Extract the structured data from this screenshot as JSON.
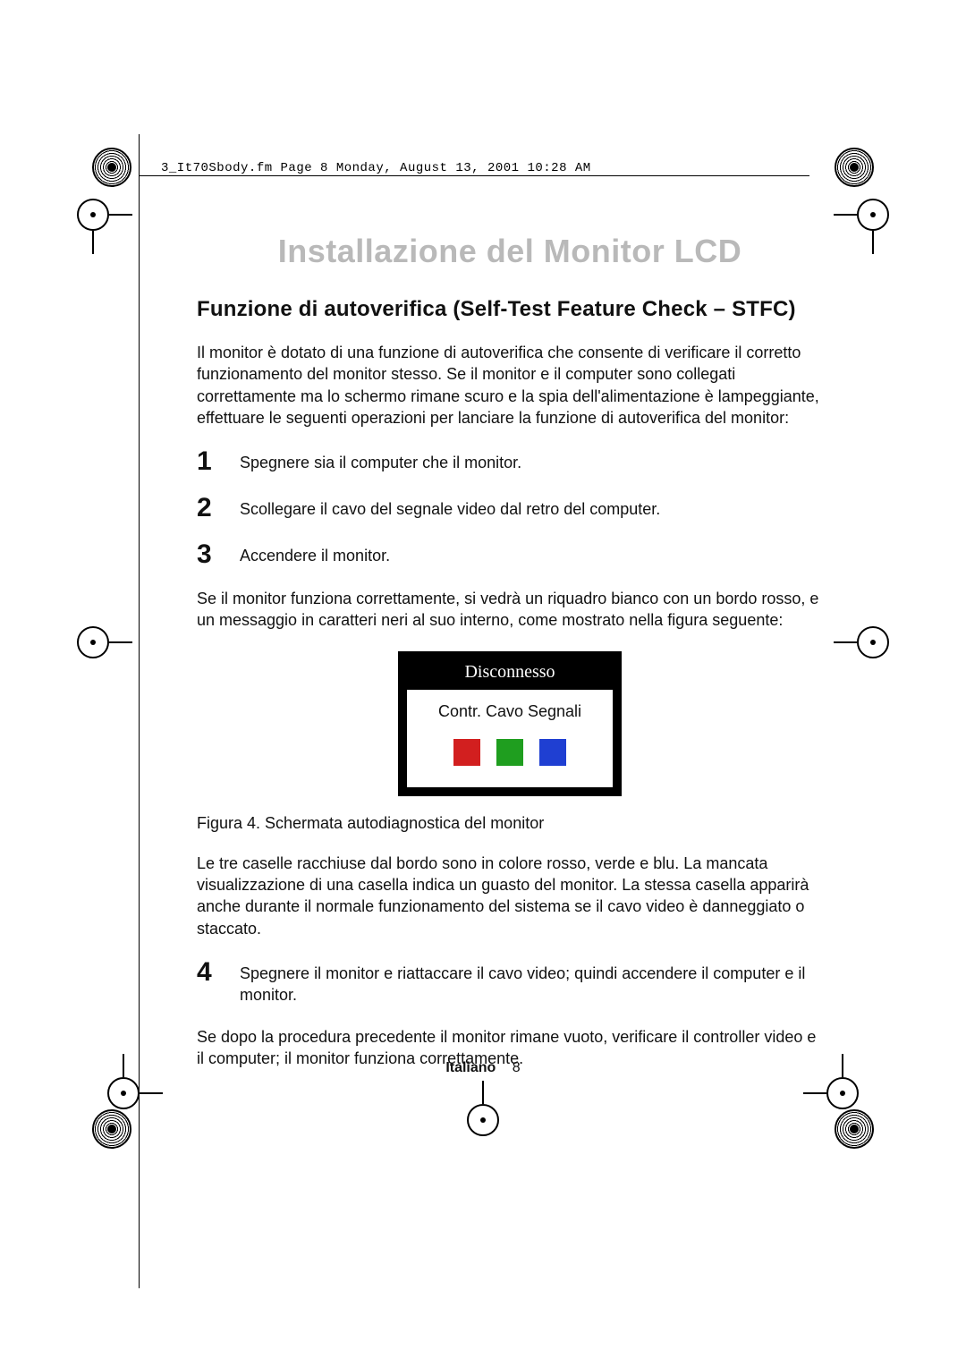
{
  "header_line": "3_It70Sbody.fm  Page 8  Monday, August 13, 2001  10:28 AM",
  "title": "Installazione del Monitor LCD",
  "subtitle": "Funzione di autoverifica (Self-Test Feature Check – STFC)",
  "intro": "Il monitor è dotato di una funzione di autoverifica che consente di verificare il corretto funzionamento del monitor stesso. Se il monitor e il computer sono collegati correttamente ma lo schermo rimane scuro e la spia dell'alimentazione è lampeggiante, effettuare le seguenti operazioni per lanciare la funzione di autoverifica del monitor:",
  "steps": {
    "s1": {
      "num": "1",
      "text": "Spegnere sia il computer che il monitor."
    },
    "s2": {
      "num": "2",
      "text": "Scollegare il cavo del segnale video dal retro del computer."
    },
    "s3": {
      "num": "3",
      "text": "Accendere il monitor."
    }
  },
  "after_steps": "Se il monitor funziona correttamente, si vedrà un riquadro bianco con un bordo rosso, e un messaggio in caratteri neri al suo interno, come mostrato nella figura seguente:",
  "figure": {
    "outer_label": "Disconnesso",
    "inner_label": "Contr. Cavo Segnali",
    "colors": {
      "r": "#d21f1f",
      "g": "#1f9e1f",
      "b": "#1f3fd2"
    },
    "caption": "Figura 4.  Schermata autodiagnostica del monitor"
  },
  "para2": "Le tre caselle racchiuse dal bordo sono in colore rosso, verde e blu. La mancata visualizzazione di una casella indica un guasto del monitor. La stessa casella apparirà anche durante il normale funzionamento del sistema se il  cavo video è danneggiato o staccato.",
  "step4": {
    "num": "4",
    "text": "Spegnere il monitor e riattaccare il cavo video; quindi accendere il computer e il monitor."
  },
  "para3": "Se dopo la procedura precedente il monitor rimane vuoto, verificare il controller video e il computer; il monitor funziona correttamente.",
  "footer": {
    "lang": "Italiano",
    "page": "8"
  }
}
